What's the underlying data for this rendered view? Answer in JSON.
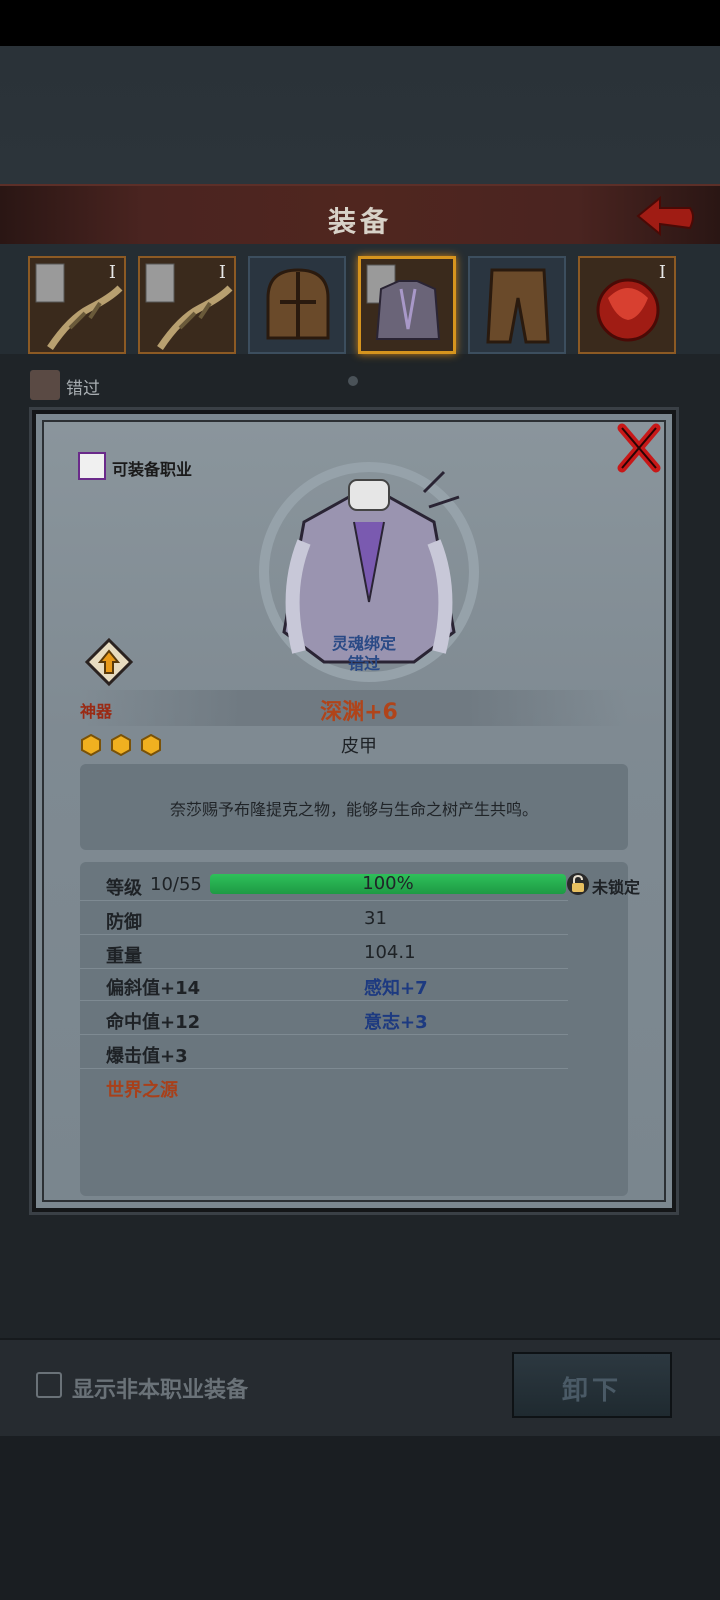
{
  "header": {
    "title": "装备"
  },
  "slots": [
    {
      "name": "weapon-slot-1",
      "tier": "I",
      "selected": false
    },
    {
      "name": "weapon-slot-2",
      "tier": "I",
      "selected": false
    },
    {
      "name": "helmet-slot",
      "tier": "",
      "selected": false
    },
    {
      "name": "armor-slot",
      "tier": "",
      "selected": true
    },
    {
      "name": "pants-slot",
      "tier": "",
      "selected": false
    },
    {
      "name": "emblem-slot",
      "tier": "I",
      "selected": false
    }
  ],
  "character": {
    "name": "错过"
  },
  "item": {
    "class_label": "可装备职业",
    "bind_status": "灵魂绑定",
    "bind_owner": "错过",
    "rarity": "神器",
    "name": "深渊+6",
    "type": "皮甲",
    "star_count": 3,
    "description": "奈莎赐予布隆提克之物，能够与生命之树产生共鸣。",
    "level_label": "等级",
    "level_value": "10/55",
    "xp_percent": 100,
    "xp_text": "100%",
    "lock_status": "未锁定",
    "stats": [
      {
        "label": "防御",
        "value": "31"
      },
      {
        "label": "重量",
        "value": "104.1"
      },
      {
        "label": "偏斜值+14",
        "right": "感知+7"
      },
      {
        "label": "命中值+12",
        "right": "意志+3"
      },
      {
        "label": "爆击值+3"
      }
    ],
    "set_name": "世界之源"
  },
  "footer": {
    "checkbox_label": "显示非本职业装备",
    "unequip_label": "卸下"
  },
  "colors": {
    "accent_orange": "#d6941e",
    "title_red": "#4a2420",
    "xp_green": "#2ec05a"
  }
}
